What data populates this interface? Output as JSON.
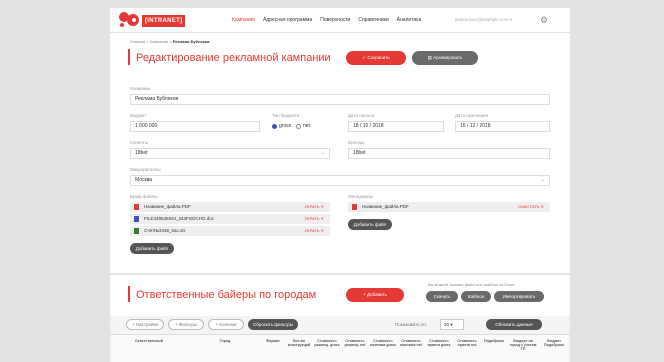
{
  "nav": {
    "brand": "[INTRANET]",
    "items": [
      "Кампании",
      "Адресная программа",
      "Поверхности",
      "Справочники",
      "Аналитика"
    ],
    "user": "ivanov.ivan@example.com"
  },
  "breadcrumb": {
    "items": [
      "Главная",
      "Кампании"
    ],
    "current": "Реклама Бублеков"
  },
  "header": {
    "title": "Редактирование рекламной кампании",
    "save_label": "Сохранить",
    "archive_label": "Архивировать"
  },
  "form": {
    "name_label": "Название",
    "name_value": "Реклама Бублеков",
    "budget_label": "Бюджет",
    "budget_value": "1 000 000",
    "budget_type_label": "Тип бюджета",
    "budget_type_options": [
      "gross",
      "net"
    ],
    "budget_type_selected": "gross",
    "start_label": "Дата начала",
    "start_value": "18 / 10 / 2018",
    "end_label": "Дата окончания",
    "end_value": "16 / 12 / 2018",
    "clients_label": "Клиенты",
    "clients_value": "18bet",
    "brands_label": "Бренды",
    "brands_value": "18bet",
    "regions_label": "Макрорегионы",
    "regions_value": "Москва",
    "brief_label": "Бриф файлы",
    "managers_label": "Менеджеры",
    "brief_files": [
      {
        "name": "Название_файла.PDF",
        "action": "УБРАТЬ",
        "type": "pdf"
      },
      {
        "name": "FILE348535934_343FGDCHG.doc",
        "action": "УБРАТЬ",
        "type": "doc"
      },
      {
        "name": "Cчёт№3436_6ас.xls",
        "action": "УБРАТЬ",
        "type": "xls"
      }
    ],
    "manager_files": [
      {
        "name": "Название_файла.PDF",
        "action": "ОЧИСТИТЬ",
        "type": "pdf"
      }
    ],
    "add_file_label": "Добавить файл"
  },
  "buyers": {
    "title": "Ответственные байеры по городам",
    "add_label": "Добавить",
    "hint": "Вы можете скачать файл или шаблон из Excel:",
    "download_label": "Скачать",
    "template_label": "Шаблон",
    "import_label": "Импортировать"
  },
  "table": {
    "settings_label": "+ Настройки",
    "filters_label": "+ Фильтры",
    "columns_label": "+ Колонки",
    "reset_label": "Сбросить фильтры",
    "per_page_label": "Показывать по:",
    "per_page_value": "20",
    "refresh_label": "Обновить данные",
    "headers": [
      "Ответственный",
      "Город",
      "Формат",
      "Кол-во конструкций",
      "Стоимость размещ. grass",
      "Стоимость размещ. net",
      "Стоимость монтажа grass",
      "Стоимость монтажа net",
      "Стоимость принта grass",
      "Стоимость принта net",
      "Подобрано",
      "Бюджет на город с учетом ТП",
      "Бюджет Подобрано"
    ]
  },
  "colors": {
    "accent": "#e53935",
    "bg": "#e3e3e3"
  }
}
